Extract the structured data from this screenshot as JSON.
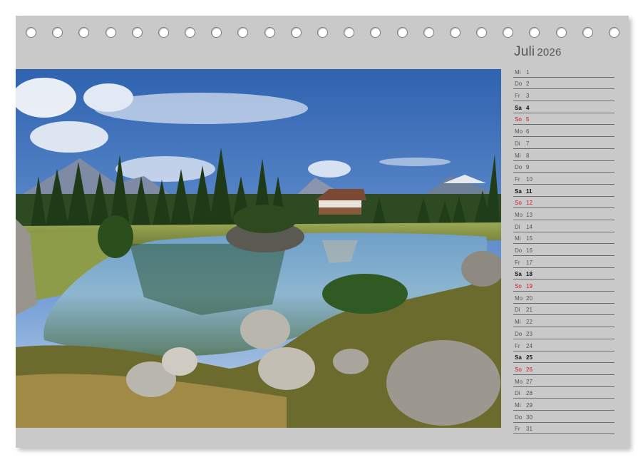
{
  "calendar": {
    "month": "Juli",
    "year": "2026",
    "photo_subject": "mountain-lake-landscape",
    "colors": {
      "sheet": "#c9c9c9",
      "sunday": "#d01818",
      "saturday": "#111111",
      "weekday": "#555555"
    },
    "days": [
      {
        "dn": "Mi",
        "d": "1",
        "type": "weekday"
      },
      {
        "dn": "Do",
        "d": "2",
        "type": "weekday"
      },
      {
        "dn": "Fr",
        "d": "3",
        "type": "weekday"
      },
      {
        "dn": "Sa",
        "d": "4",
        "type": "sat"
      },
      {
        "dn": "So",
        "d": "5",
        "type": "sun"
      },
      {
        "dn": "Mo",
        "d": "6",
        "type": "weekday"
      },
      {
        "dn": "Di",
        "d": "7",
        "type": "weekday"
      },
      {
        "dn": "Mi",
        "d": "8",
        "type": "weekday"
      },
      {
        "dn": "Do",
        "d": "9",
        "type": "weekday"
      },
      {
        "dn": "Fr",
        "d": "10",
        "type": "weekday"
      },
      {
        "dn": "Sa",
        "d": "11",
        "type": "sat"
      },
      {
        "dn": "So",
        "d": "12",
        "type": "sun"
      },
      {
        "dn": "Mo",
        "d": "13",
        "type": "weekday"
      },
      {
        "dn": "Di",
        "d": "14",
        "type": "weekday"
      },
      {
        "dn": "Mi",
        "d": "15",
        "type": "weekday"
      },
      {
        "dn": "Do",
        "d": "16",
        "type": "weekday"
      },
      {
        "dn": "Fr",
        "d": "17",
        "type": "weekday"
      },
      {
        "dn": "Sa",
        "d": "18",
        "type": "sat"
      },
      {
        "dn": "So",
        "d": "19",
        "type": "sun"
      },
      {
        "dn": "Mo",
        "d": "20",
        "type": "weekday"
      },
      {
        "dn": "Di",
        "d": "21",
        "type": "weekday"
      },
      {
        "dn": "Mi",
        "d": "22",
        "type": "weekday"
      },
      {
        "dn": "Do",
        "d": "23",
        "type": "weekday"
      },
      {
        "dn": "Fr",
        "d": "24",
        "type": "weekday"
      },
      {
        "dn": "Sa",
        "d": "25",
        "type": "sat"
      },
      {
        "dn": "So",
        "d": "26",
        "type": "sun"
      },
      {
        "dn": "Mo",
        "d": "27",
        "type": "weekday"
      },
      {
        "dn": "Di",
        "d": "28",
        "type": "weekday"
      },
      {
        "dn": "Mi",
        "d": "29",
        "type": "weekday"
      },
      {
        "dn": "Do",
        "d": "30",
        "type": "weekday"
      },
      {
        "dn": "Fr",
        "d": "31",
        "type": "weekday"
      }
    ]
  }
}
